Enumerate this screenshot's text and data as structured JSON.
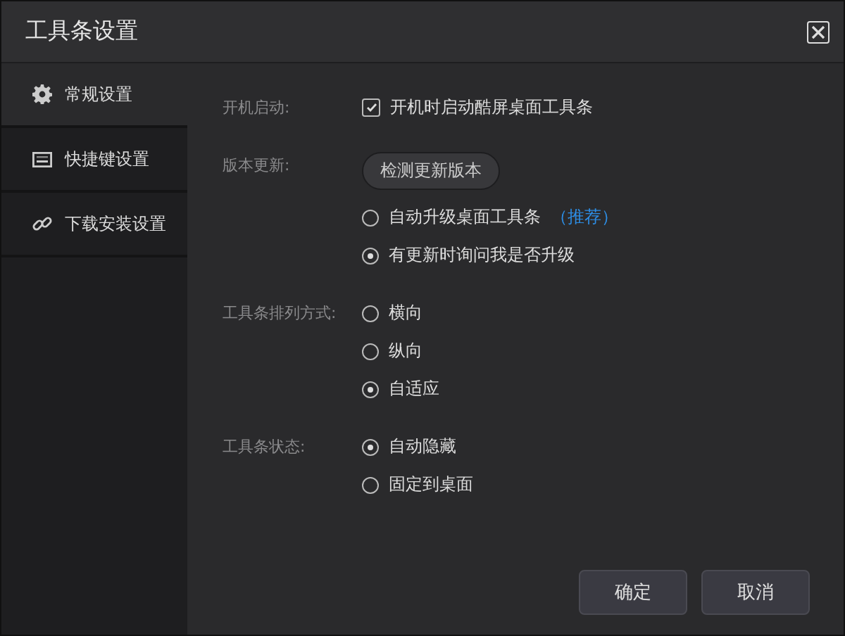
{
  "window": {
    "title": "工具条设置"
  },
  "sidebar": {
    "items": [
      {
        "label": "常规设置",
        "kind": "gear",
        "selected": true
      },
      {
        "label": "快捷键设置",
        "kind": "keyboard",
        "selected": false
      },
      {
        "label": "下载安装设置",
        "kind": "link",
        "selected": false
      }
    ]
  },
  "sections": [
    {
      "label": "开机启动:",
      "controls": [
        {
          "kind": "checkbox",
          "label": "开机时启动酷屏桌面工具条",
          "checked": true
        }
      ]
    },
    {
      "label": "版本更新:",
      "controls": [
        {
          "kind": "button",
          "label": "检测更新版本"
        },
        {
          "kind": "radio",
          "label": "自动升级桌面工具条",
          "note": "（推荐）",
          "selected": false
        },
        {
          "kind": "radio",
          "label": "有更新时询问我是否升级",
          "selected": true
        }
      ]
    },
    {
      "label": "工具条排列方式:",
      "controls": [
        {
          "kind": "radio",
          "label": "横向",
          "selected": false
        },
        {
          "kind": "radio",
          "label": "纵向",
          "selected": false
        },
        {
          "kind": "radio",
          "label": "自适应",
          "selected": true
        }
      ]
    },
    {
      "label": "工具条状态:",
      "controls": [
        {
          "kind": "radio",
          "label": "自动隐藏",
          "selected": true
        },
        {
          "kind": "radio",
          "label": "固定到桌面",
          "selected": false
        }
      ]
    }
  ],
  "buttons": [
    {
      "label": "确定"
    },
    {
      "label": "取消"
    }
  ]
}
